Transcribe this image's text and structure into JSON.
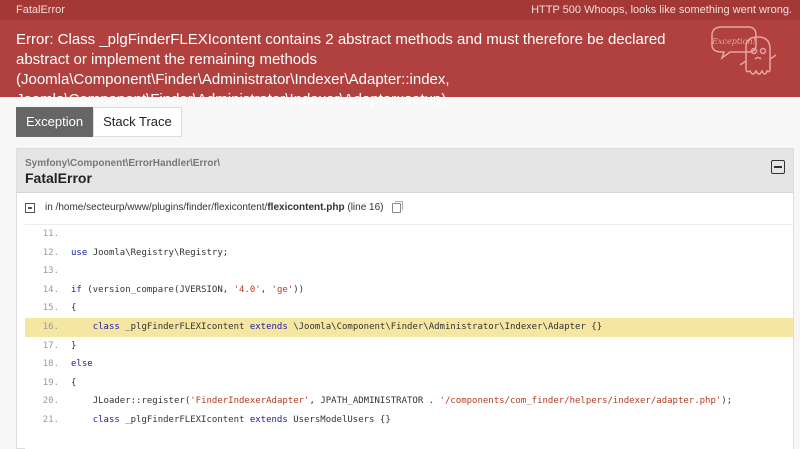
{
  "header": {
    "title": "FatalError",
    "status_code": "HTTP 500",
    "status_text": "Whoops, looks like something went wrong.",
    "message": "Error: Class _plgFinderFLEXIcontent contains 2 abstract methods and must therefore be declared abstract or implement the remaining methods (Joomla\\Component\\Finder\\Administrator\\Indexer\\Adapter::index, Joomla\\Component\\Finder\\Administrator\\Indexer\\Adapter::setup)",
    "mascot_label": "Exception!"
  },
  "tabs": [
    {
      "label": "Exception",
      "active": true
    },
    {
      "label": "Stack Trace",
      "active": false
    }
  ],
  "exception": {
    "class_name": "Symfony\\Component\\ErrorHandler\\Error\\",
    "title": "FatalError",
    "file_prefix": "in /home/secteurp/www/plugins/finder/flexicontent/",
    "file_name": "flexicontent.php",
    "file_suffix": "(line 16)"
  },
  "code_lines": [
    {
      "num": "11.",
      "text": ""
    },
    {
      "num": "12.",
      "text": "use Joomla\\Registry\\Registry;"
    },
    {
      "num": "13.",
      "text": ""
    },
    {
      "num": "14.",
      "text": "if (version_compare(JVERSION, '4.0', 'ge'))"
    },
    {
      "num": "15.",
      "text": "{"
    },
    {
      "num": "16.",
      "text": "    class _plgFinderFLEXIcontent extends \\Joomla\\Component\\Finder\\Administrator\\Indexer\\Adapter {}"
    },
    {
      "num": "17.",
      "text": "}"
    },
    {
      "num": "18.",
      "text": "else"
    },
    {
      "num": "19.",
      "text": "{"
    },
    {
      "num": "20.",
      "text": "    JLoader::register('FinderIndexerAdapter', JPATH_ADMINISTRATOR . '/components/com_finder/helpers/indexer/adapter.php');"
    },
    {
      "num": "21.",
      "text": "    class _plgFinderFLEXIcontent extends UsersModelUsers {}"
    }
  ],
  "highlighted_line": "16.",
  "colors": {
    "header_bg": "#b0413e",
    "topbar_bg": "#a33835",
    "tab_active_bg": "#666666",
    "highlight_bg": "#f5e6a2",
    "keyword": "#1a1aa6",
    "string": "#b33c1f"
  }
}
